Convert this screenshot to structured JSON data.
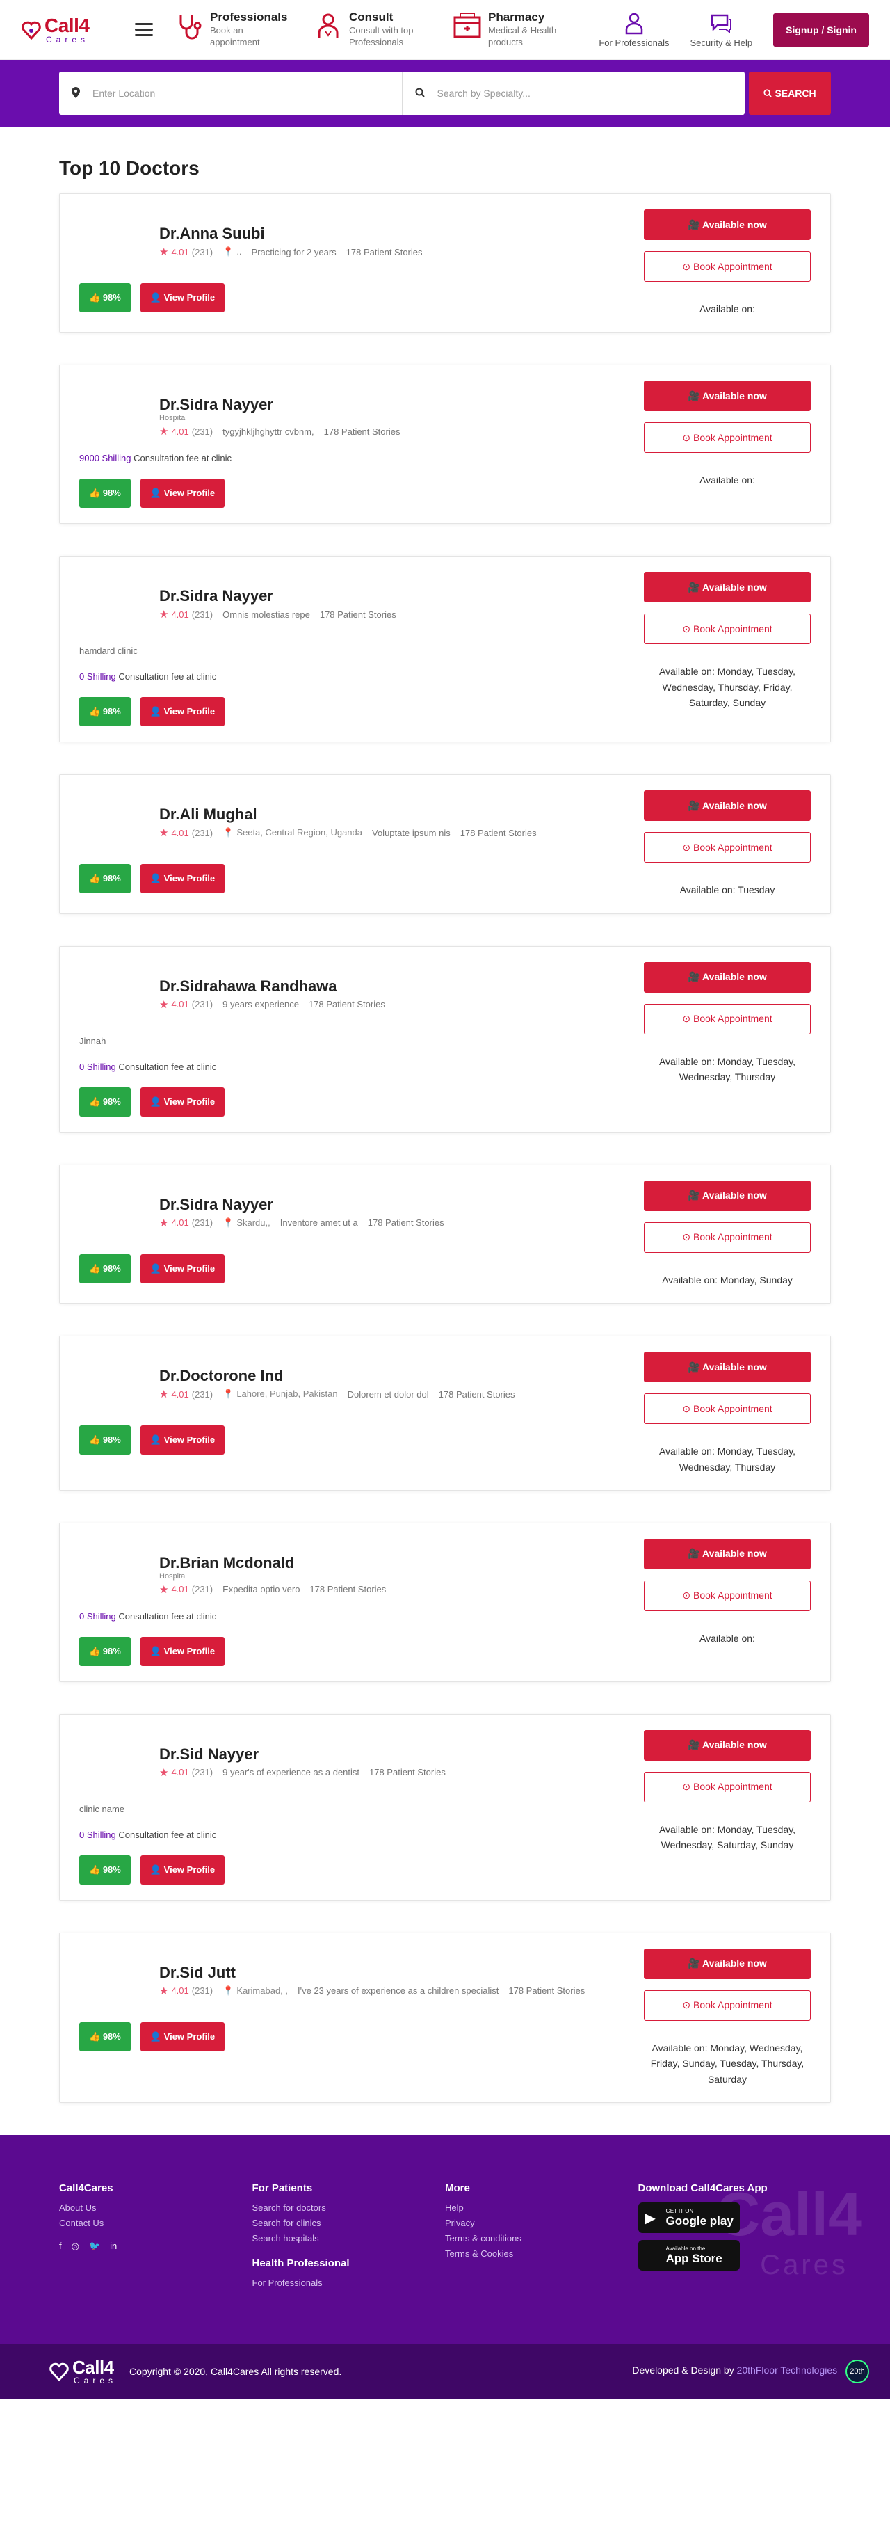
{
  "header": {
    "logo_top": "Call4",
    "logo_bottom": "Cares",
    "nav": [
      {
        "title": "Professionals",
        "sub": "Book an appointment",
        "icon": "stethoscope-icon"
      },
      {
        "title": "Consult",
        "sub": "Consult with top Professionals",
        "icon": "doctor-icon"
      },
      {
        "title": "Pharmacy",
        "sub": "Medical & Health products",
        "icon": "pharmacy-icon"
      }
    ],
    "for_professionals": "For Professionals",
    "security_help": "Security & Help",
    "signup": "Signup / Signin"
  },
  "search": {
    "location_placeholder": "Enter Location",
    "specialty_placeholder": "Search by Specialty...",
    "button": "SEARCH"
  },
  "page_title": "Top 10 Doctors",
  "labels": {
    "available_now": "Available now",
    "book_appointment": "Book Appointment",
    "view_profile": "View Profile",
    "like_pct": "98%",
    "rating": "4.01",
    "reviews": "(231)",
    "patient_stories": "178 Patient Stories",
    "fee_suffix": "Consultation fee at clinic"
  },
  "doctors": [
    {
      "name": "Dr.Anna Suubi",
      "sub": "",
      "location": "..",
      "exp": "Practicing for 2 years",
      "clinic": "",
      "fee": "",
      "available": "Available on:"
    },
    {
      "name": "Dr.Sidra Nayyer",
      "sub": "Hospital",
      "location": "",
      "exp": "tygyjhkljhghyttr cvbnm,",
      "clinic": "",
      "fee": "9000 Shilling",
      "available": "Available on:"
    },
    {
      "name": "Dr.Sidra Nayyer",
      "sub": "",
      "location": "",
      "exp": "Omnis molestias repe",
      "clinic": "hamdard clinic",
      "fee": "0 Shilling",
      "available": "Available on: Monday, Tuesday, Wednesday, Thursday, Friday, Saturday, Sunday"
    },
    {
      "name": "Dr.Ali Mughal",
      "sub": "",
      "location": "Seeta, Central Region, Uganda",
      "exp": "Voluptate ipsum nis",
      "clinic": "",
      "fee": "",
      "available": "Available on: Tuesday"
    },
    {
      "name": "Dr.Sidrahawa Randhawa",
      "sub": "",
      "location": "",
      "exp": "9 years experience",
      "clinic": "Jinnah",
      "fee": "0 Shilling",
      "available": "Available on: Monday, Tuesday, Wednesday, Thursday"
    },
    {
      "name": "Dr.Sidra Nayyer",
      "sub": "",
      "location": "Skardu,,",
      "exp": "Inventore amet ut a",
      "clinic": "",
      "fee": "",
      "available": "Available on: Monday, Sunday"
    },
    {
      "name": "Dr.Doctorone Ind",
      "sub": "",
      "location": "Lahore, Punjab, Pakistan",
      "exp": "Dolorem et dolor dol",
      "clinic": "",
      "fee": "",
      "available": "Available on: Monday, Tuesday, Wednesday, Thursday"
    },
    {
      "name": "Dr.Brian Mcdonald",
      "sub": "Hospital",
      "location": "",
      "exp": "Expedita optio vero",
      "clinic": "",
      "fee": "0 Shilling",
      "available": "Available on:"
    },
    {
      "name": "Dr.Sid Nayyer",
      "sub": "",
      "location": "",
      "exp": "9 year's of experience as a dentist",
      "clinic": "clinic name",
      "fee": "0 Shilling",
      "available": "Available on: Monday, Tuesday, Wednesday, Saturday, Sunday"
    },
    {
      "name": "Dr.Sid Jutt",
      "sub": "",
      "location": "Karimabad, ,",
      "exp": "I've 23 years of experience as a children specialist",
      "clinic": "",
      "fee": "",
      "available": "Available on: Monday, Wednesday, Friday, Sunday, Tuesday, Thursday, Saturday"
    }
  ],
  "footer": {
    "col1_title": "Call4Cares",
    "col1_links": [
      "About Us",
      "Contact Us"
    ],
    "col2_title": "For Patients",
    "col2_links": [
      "Search for doctors",
      "Search for clinics",
      "Search hospitals"
    ],
    "col2b_title": "Health Professional",
    "col2b_links": [
      "For Professionals"
    ],
    "col3_title": "More",
    "col3_links": [
      "Help",
      "Privacy",
      "Terms & conditions",
      "Terms & Cookies"
    ],
    "col4_title": "Download Call4Cares App",
    "google_small": "GET IT ON",
    "google_big": "Google play",
    "apple_small": "Available on the",
    "apple_big": "App Store",
    "watermark": "Call4",
    "watermark2": "Cares",
    "copyright": "Copyright © 2020, Call4Cares All rights reserved.",
    "credit": "Developed & Design by",
    "credit_company": "20thFloor Technologies",
    "credit_badge": "20th"
  }
}
